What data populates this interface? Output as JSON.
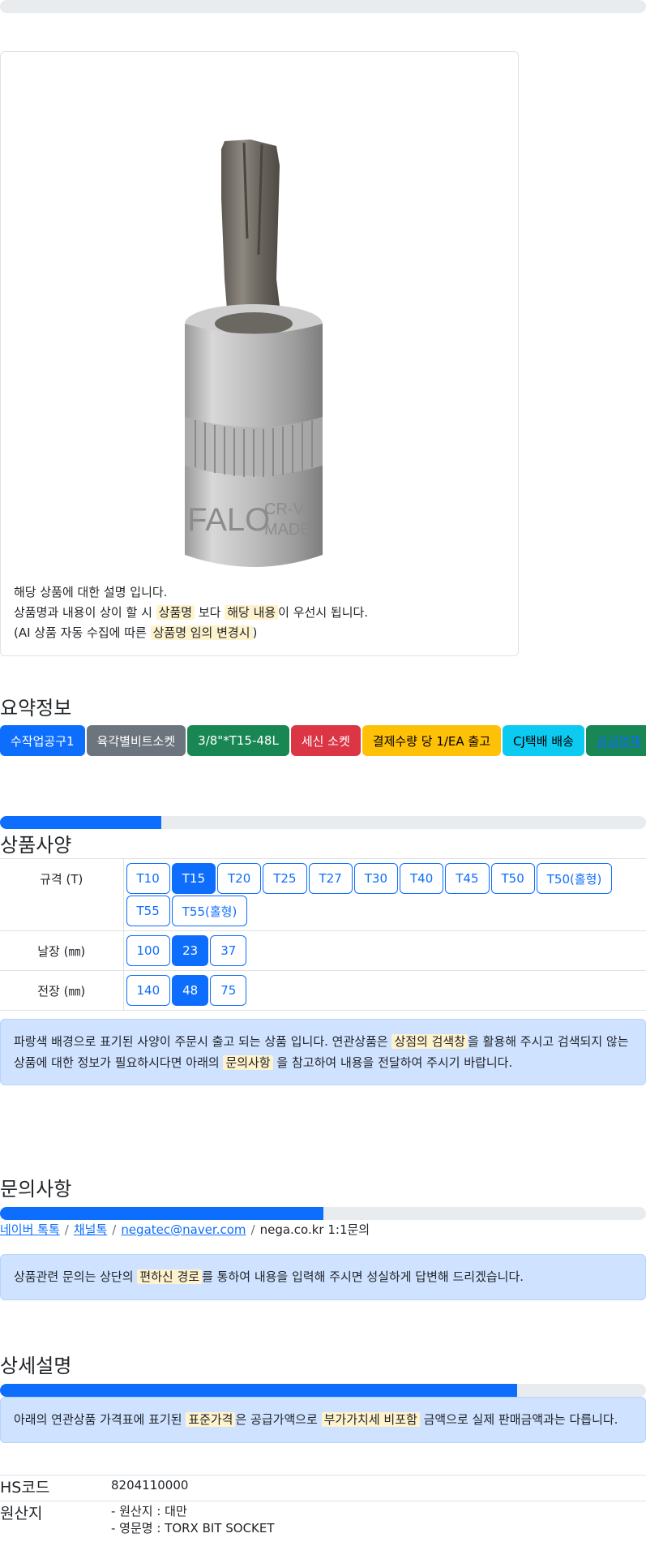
{
  "progress": {
    "top": 0,
    "summary": 20,
    "inquiry": 50,
    "detail": 80
  },
  "notice": {
    "line1": "해당 상품에 대한 설명 입니다.",
    "line2_a": "상품명과 내용이 상이 할 시 ",
    "line2_h1": "상품명",
    "line2_b": " 보다 ",
    "line2_h2": "해당 내용",
    "line2_c": "이 우선시 됩니다.",
    "line3_a": "(AI 상품 자동 수집에 따른 ",
    "line3_h": "상품명 임의 변경시",
    "line3_b": ")"
  },
  "summary": {
    "title": "요약정보",
    "badges": [
      {
        "label": "수작업공구1",
        "color": "#0d6efd"
      },
      {
        "label": "육각별비트소켓",
        "color": "#6c757d"
      },
      {
        "label": "3/8\"*T15-48L",
        "color": "#198754"
      },
      {
        "label": "세신 소켓",
        "color": "#dc3545"
      },
      {
        "label": "결제수량 당 1/EA 출고",
        "color": "#ffc107"
      },
      {
        "label": "CJ택배 배송",
        "color": "#0dcaf0"
      },
      {
        "label": "공급업체",
        "color": "#198754"
      }
    ]
  },
  "spec": {
    "title": "상품사양",
    "rows": [
      {
        "label": "규격 (T)",
        "options": [
          "T10",
          "T15",
          "T20",
          "T25",
          "T27",
          "T30",
          "T40",
          "T45",
          "T50",
          "T50(홀형)",
          "T55",
          "T55(홀형)"
        ],
        "selected": "T15"
      },
      {
        "label": "날장 (㎜)",
        "options": [
          "100",
          "23",
          "37"
        ],
        "selected": "23"
      },
      {
        "label": "전장 (㎜)",
        "options": [
          "140",
          "48",
          "75"
        ],
        "selected": "48"
      }
    ],
    "alert_a": "파랑색 배경으로 표기된 사양이 주문시 출고 되는 상품 입니다. 연관상품은 ",
    "alert_h1": "상점의 검색창",
    "alert_b": "을 활용해 주시고 검색되지 않는 상품에 대한 정보가 필요하시다면 아래의 ",
    "alert_h2": "문의사항",
    "alert_c": " 을 참고하여 내용을 전달하여 주시기 바랍니다."
  },
  "inquiry": {
    "title": "문의사항",
    "links": [
      "네이버 톡톡",
      "채널톡",
      "negatec@naver.com"
    ],
    "plain": "nega.co.kr 1:1문의",
    "alert_a": "상품관련 문의는 상단의 ",
    "alert_h": "편하신 경로",
    "alert_b": "를 통하여 내용을 입력해 주시면 성실하게 답변해 드리겠습니다."
  },
  "detail": {
    "title": "상세설명",
    "alert_a": "아래의 연관상품 가격표에 표기된 ",
    "alert_h1": "표준가격",
    "alert_b": "은 공급가액으로 ",
    "alert_h2": "부가가치세 비포함",
    "alert_c": " 금액으로 실제 판매금액과는 다릅니다.",
    "hs_label": "HS코드",
    "hs_value": "8204110000",
    "origin_label": "원산지",
    "origin_line1": "- 원산지 : 대만",
    "origin_line2": "- 영문명 : TORX BIT SOCKET"
  },
  "image": {
    "text1": "FALO",
    "text2": "CR-V",
    "text3": "MADE"
  }
}
